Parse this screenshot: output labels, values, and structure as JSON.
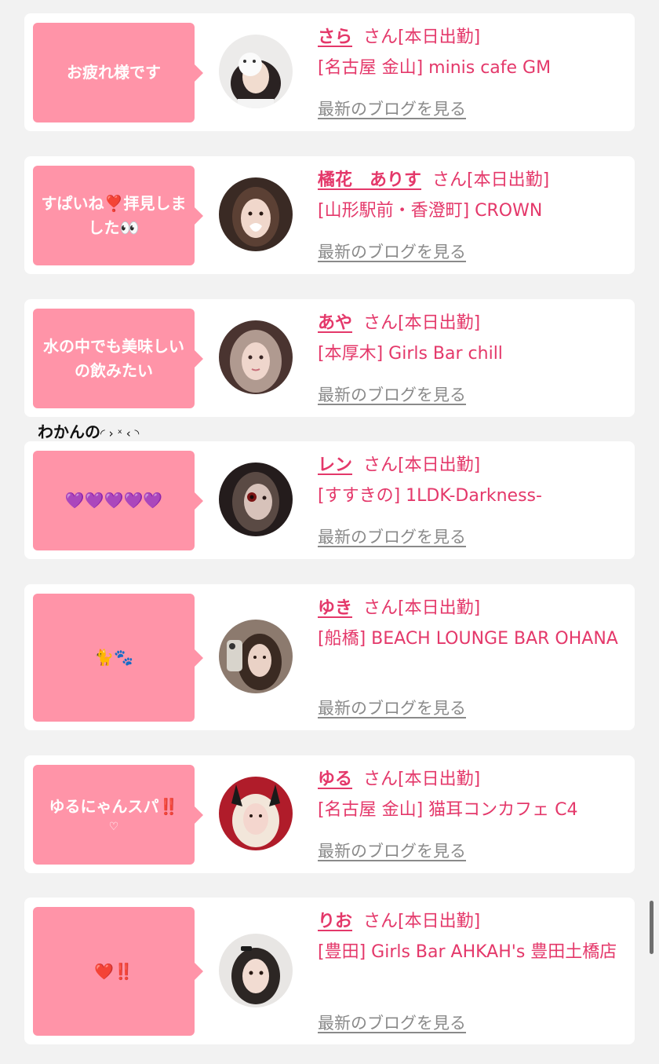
{
  "suffix": "さん",
  "attendance": "[本日出勤]",
  "blog_link": "最新のブログを見る",
  "floating_text": "わかんの",
  "floating_kaomoji": "◜ › ˣ ‹ ◝",
  "colors": {
    "accent": "#e4386a",
    "bubble": "#ff94a8",
    "link": "#8a8a8a",
    "background": "#f2f2f2"
  },
  "cards": [
    {
      "message": "お疲れ様です",
      "message_sub": "",
      "name": "さら",
      "shop": "[名古屋 金山] minis cafe GM",
      "avatar": "girl-with-plush-photo"
    },
    {
      "message": "すぱいね❣️拝見しました👀",
      "message_sub": "",
      "name": "橘花　ありす",
      "shop": "[山形駅前・香澄町] CROWN",
      "avatar": "girl-with-heart-sticker-photo"
    },
    {
      "message": "水の中でも美味しいの飲みたい",
      "message_sub": "",
      "name": "あや",
      "shop": "[本厚木] Girls Bar chill",
      "avatar": "girl-portrait-photo"
    },
    {
      "message": "💜💜💜💜💜",
      "message_sub": "",
      "name": "レン",
      "shop": "[すすきの] 1LDK-Darkness-",
      "avatar": "girl-red-contact-photo"
    },
    {
      "message": "🐈🐾",
      "message_sub": "",
      "name": "ゆき",
      "shop": "[船橋] BEACH LOUNGE BAR OHANA",
      "avatar": "girl-selfie-photo"
    },
    {
      "message": "ゆるにゃんスパ‼️",
      "message_sub": "♡",
      "name": "ゆる",
      "shop": "[名古屋 金山] 猫耳コンカフェ C4",
      "avatar": "girl-bunny-ears-photo"
    },
    {
      "message": "❤️‼️",
      "message_sub": "",
      "name": "りお",
      "shop": "[豊田] Girls Bar AHKAH's 豊田土橋店",
      "avatar": "girl-with-clip-photo"
    }
  ]
}
